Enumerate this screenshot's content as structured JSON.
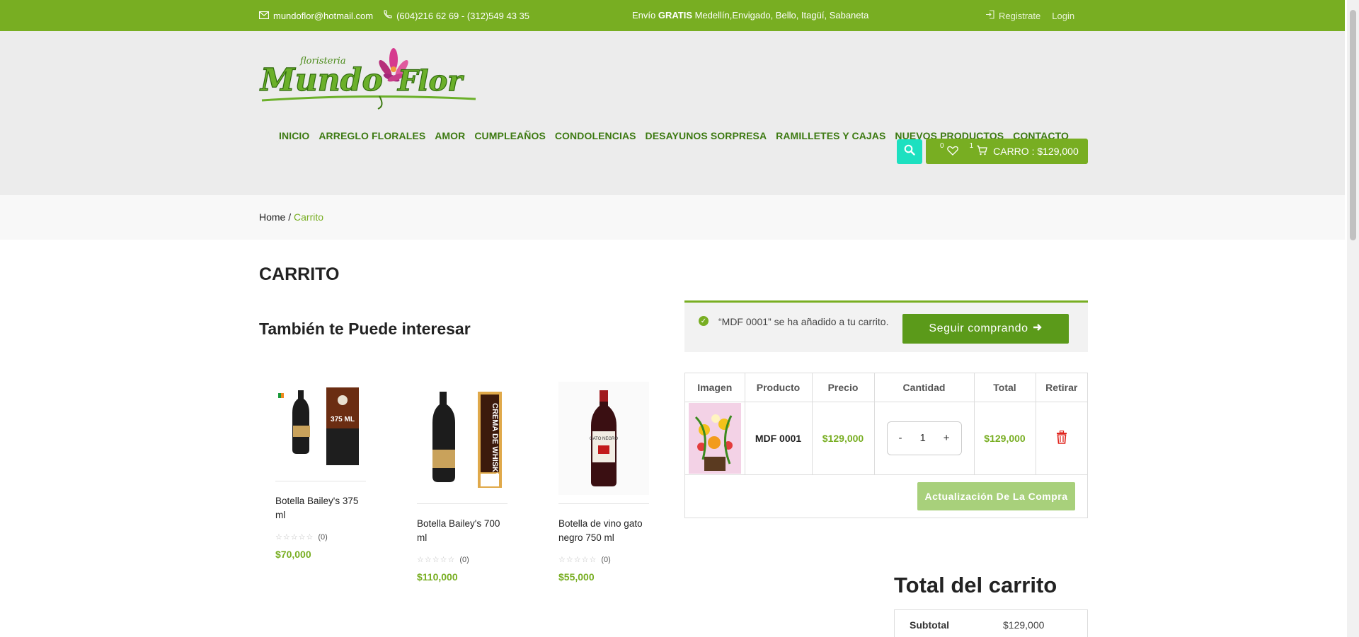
{
  "topbar": {
    "email": "mundoflor@hotmail.com",
    "phone": "(604)216 62 69 - (312)549 43 35",
    "shipping_prefix": "Envío ",
    "shipping_bold": "GRATIS",
    "shipping_rest": " Medellín,Envigado, Bello, Itagüí, Sabaneta",
    "register": "Registrate",
    "login": "Login"
  },
  "logo": {
    "script_small": "floristeria",
    "brand": "Mundo Flor"
  },
  "nav": [
    "INICIO",
    "ARREGLO FLORALES",
    "AMOR",
    "CUMPLEAÑOS",
    "CONDOLENCIAS",
    "DESAYUNOS SORPRESA",
    "RAMILLETES Y CAJAS",
    "NUEVOS PRODUCTOS",
    "CONTACTO"
  ],
  "header_cart": {
    "wishlist_count": "0",
    "cart_count": "1",
    "label": "CARRO : $129,000"
  },
  "breadcrumb": {
    "home": "Home",
    "sep": " / ",
    "current": "Carrito"
  },
  "page_title": "CARRITO",
  "cross_sells": {
    "title": "También te Puede interesar",
    "products": [
      {
        "name": "Botella Bailey's 375 ml",
        "reviews": "(0)",
        "price": "$70,000",
        "image_text": "375 ML"
      },
      {
        "name": "Botella Bailey's 700 ml",
        "reviews": "(0)",
        "price": "$110,000",
        "image_text": "CREMA DE WHISKY"
      },
      {
        "name": "Botella de vino gato negro 750 ml",
        "reviews": "(0)",
        "price": "$55,000",
        "image_text": "GATO NEGRO"
      }
    ]
  },
  "notice": {
    "message": "“MDF 0001” se ha añadido a tu carrito.",
    "button": "Seguir comprando"
  },
  "cart_table": {
    "headers": [
      "Imagen",
      "Producto",
      "Precio",
      "Cantidad",
      "Total",
      "Retirar"
    ],
    "row": {
      "product": "MDF 0001",
      "price": "$129,000",
      "qty": "1",
      "minus": "-",
      "plus": "+",
      "total": "$129,000"
    },
    "update_button": "Actualización De La Compra"
  },
  "totals": {
    "title": "Total del carrito",
    "subtotal_label": "Subtotal",
    "subtotal_value": "$129,000"
  },
  "colors": {
    "brand_green": "#78ae22",
    "dark_green": "#3d7a12",
    "teal": "#1de0c0",
    "delete_red": "#e0261f"
  }
}
